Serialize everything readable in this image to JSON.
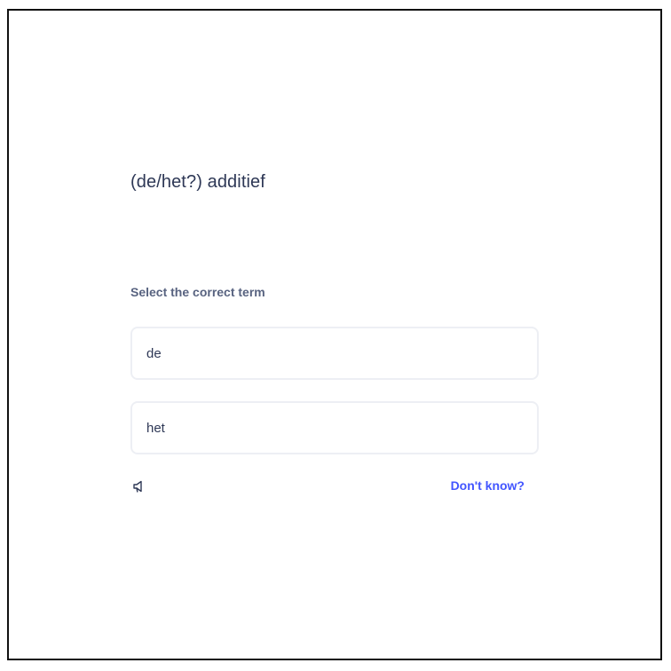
{
  "question": {
    "term": "(de/het?) additief",
    "prompt": "Select the correct term"
  },
  "options": [
    {
      "label": "de"
    },
    {
      "label": "het"
    }
  ],
  "footer": {
    "audio_icon": "speaker-icon",
    "dont_know_label": "Don't know?"
  },
  "colors": {
    "accent": "#4255ff",
    "text_primary": "#2e3856",
    "text_secondary": "#586380",
    "option_border": "#edeff4",
    "frame_border": "#111111"
  }
}
